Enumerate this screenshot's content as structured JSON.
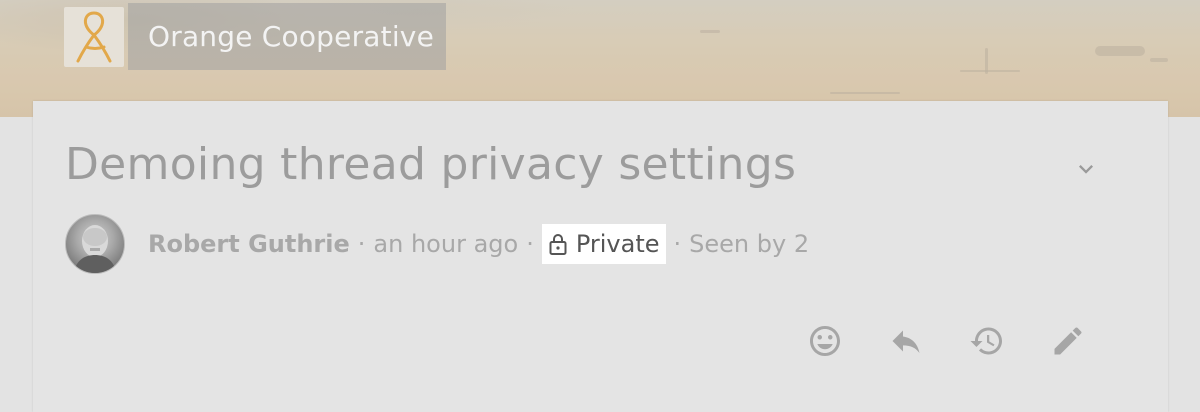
{
  "group": {
    "name": "Orange Cooperative",
    "logo_icon": "orange-cooperative-logo-icon",
    "logo_color": "#e2a84a"
  },
  "thread": {
    "title": "Demoing thread privacy settings",
    "author": "Robert Guthrie",
    "time": "an hour ago",
    "privacy_label": "Private",
    "seen_by": "Seen by 2",
    "separator": "·"
  },
  "icons": {
    "collapse": "chevron-down-icon",
    "privacy": "lock-icon",
    "react": "smiley-icon",
    "reply": "reply-icon",
    "history": "history-icon",
    "edit": "pencil-icon"
  },
  "colors": {
    "background": "#e3e3e3",
    "card": "#e4e4e4",
    "muted_text": "#a8a8a8",
    "icon": "#a6a6a6",
    "privacy_highlight": "#ffffff"
  }
}
